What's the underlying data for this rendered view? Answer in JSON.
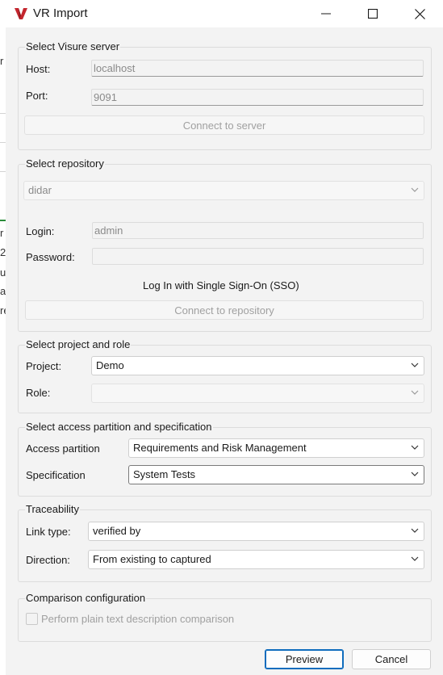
{
  "window": {
    "title": "VR Import"
  },
  "background_fragments": [
    "r",
    "r",
    "2",
    "u",
    "a",
    "re"
  ],
  "server": {
    "legend": "Select Visure server",
    "host_label": "Host:",
    "host_value": "localhost",
    "port_label": "Port:",
    "port_value": "9091",
    "connect_label": "Connect to server"
  },
  "repository": {
    "legend": "Select repository",
    "selected": "didar",
    "login_label": "Login:",
    "login_value": "admin",
    "password_label": "Password:",
    "password_value": "",
    "sso_label": "Log In with Single Sign-On (SSO)",
    "connect_label": "Connect to repository"
  },
  "project": {
    "legend": "Select project and role",
    "project_label": "Project:",
    "project_value": "Demo",
    "role_label": "Role:",
    "role_value": ""
  },
  "access": {
    "legend": "Select access partition and specification",
    "partition_label": "Access partition",
    "partition_value": "Requirements and Risk Management",
    "spec_label": "Specification",
    "spec_value": "System Tests"
  },
  "traceability": {
    "legend": "Traceability",
    "link_type_label": "Link type:",
    "link_type_value": "verified by",
    "direction_label": "Direction:",
    "direction_value": "From existing to captured"
  },
  "comparison": {
    "legend": "Comparison configuration",
    "checkbox_label": "Perform plain text description comparison",
    "checked": false
  },
  "footer": {
    "preview_label": "Preview",
    "cancel_label": "Cancel"
  },
  "colors": {
    "accent_border": "#0f6cbd",
    "icon_red": "#c4262e",
    "window_bg": "#f3f3f3"
  }
}
